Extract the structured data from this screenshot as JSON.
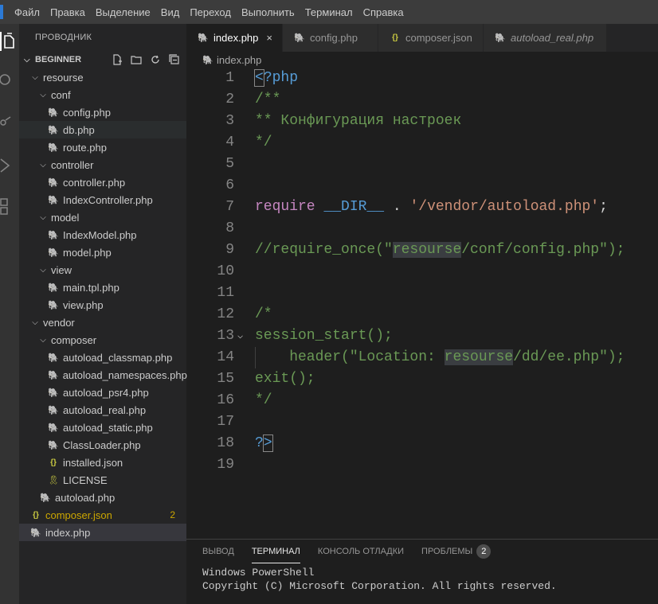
{
  "menu": [
    "Файл",
    "Правка",
    "Выделение",
    "Вид",
    "Переход",
    "Выполнить",
    "Терминал",
    "Справка"
  ],
  "activity_icons": [
    "files-icon",
    "search-icon",
    "source-control-icon",
    "run-debug-icon",
    "extensions-icon"
  ],
  "sidebar": {
    "title": "ПРОВОДНИК",
    "section": "BEGINNER",
    "actions": [
      "new-file-icon",
      "new-folder-icon",
      "refresh-icon",
      "collapse-all-icon"
    ],
    "tree": [
      {
        "label": "resourse",
        "type": "folder",
        "depth": 0
      },
      {
        "label": "conf",
        "type": "folder",
        "depth": 1
      },
      {
        "label": "config.php",
        "type": "php",
        "depth": 2
      },
      {
        "label": "db.php",
        "type": "php",
        "depth": 2,
        "hover": true
      },
      {
        "label": "route.php",
        "type": "php",
        "depth": 2
      },
      {
        "label": "controller",
        "type": "folder",
        "depth": 1
      },
      {
        "label": "controller.php",
        "type": "php",
        "depth": 2
      },
      {
        "label": "IndexController.php",
        "type": "php",
        "depth": 2
      },
      {
        "label": "model",
        "type": "folder",
        "depth": 1
      },
      {
        "label": "IndexModel.php",
        "type": "php",
        "depth": 2
      },
      {
        "label": "model.php",
        "type": "php",
        "depth": 2
      },
      {
        "label": "view",
        "type": "folder",
        "depth": 1
      },
      {
        "label": "main.tpl.php",
        "type": "php",
        "depth": 2
      },
      {
        "label": "view.php",
        "type": "php",
        "depth": 2
      },
      {
        "label": "vendor",
        "type": "folder",
        "depth": 0
      },
      {
        "label": "composer",
        "type": "folder",
        "depth": 1
      },
      {
        "label": "autoload_classmap.php",
        "type": "php",
        "depth": 2
      },
      {
        "label": "autoload_namespaces.php",
        "type": "php",
        "depth": 2
      },
      {
        "label": "autoload_psr4.php",
        "type": "php",
        "depth": 2
      },
      {
        "label": "autoload_real.php",
        "type": "php",
        "depth": 2
      },
      {
        "label": "autoload_static.php",
        "type": "php",
        "depth": 2
      },
      {
        "label": "ClassLoader.php",
        "type": "php",
        "depth": 2
      },
      {
        "label": "installed.json",
        "type": "json",
        "depth": 2
      },
      {
        "label": "LICENSE",
        "type": "license",
        "depth": 2
      },
      {
        "label": "autoload.php",
        "type": "php",
        "depth": 1
      },
      {
        "label": "composer.json",
        "type": "json",
        "depth": 0,
        "warning": true,
        "badge": "2"
      },
      {
        "label": "index.php",
        "type": "php",
        "depth": 0,
        "selected": true
      }
    ]
  },
  "tabs": [
    {
      "label": "index.php",
      "type": "php",
      "active": true,
      "close": "×"
    },
    {
      "label": "config.php",
      "type": "php"
    },
    {
      "label": "composer.json",
      "type": "json"
    },
    {
      "label": "autoload_real.php",
      "type": "php",
      "italic": true
    }
  ],
  "breadcrumb": "index.php",
  "editor": {
    "lines": [
      {
        "n": "1",
        "tokens": [
          {
            "t": "<",
            "c": "c-kw bx"
          },
          {
            "t": "?php",
            "c": "c-kw"
          }
        ]
      },
      {
        "n": "2",
        "tokens": [
          {
            "t": "/**",
            "c": "c-cm"
          }
        ]
      },
      {
        "n": "3",
        "tokens": [
          {
            "t": "** Конфигурация настроек",
            "c": "c-cm"
          }
        ]
      },
      {
        "n": "4",
        "tokens": [
          {
            "t": "*/",
            "c": "c-cm"
          }
        ]
      },
      {
        "n": "5",
        "tokens": []
      },
      {
        "n": "6",
        "tokens": []
      },
      {
        "n": "7",
        "tokens": [
          {
            "t": "require",
            "c": "c-ctl"
          },
          {
            "t": " ",
            "c": ""
          },
          {
            "t": "__DIR__",
            "c": "c-var"
          },
          {
            "t": " . ",
            "c": ""
          },
          {
            "t": "'/vendor/autoload.php'",
            "c": "c-str"
          },
          {
            "t": ";",
            "c": ""
          }
        ]
      },
      {
        "n": "8",
        "tokens": []
      },
      {
        "n": "9",
        "tokens": [
          {
            "t": "//require_once(\"",
            "c": "c-cm"
          },
          {
            "t": "resourse",
            "c": "c-cm wordhl"
          },
          {
            "t": "/conf/config.php\");",
            "c": "c-cm"
          }
        ]
      },
      {
        "n": "10",
        "tokens": []
      },
      {
        "n": "11",
        "tokens": []
      },
      {
        "n": "12",
        "tokens": [
          {
            "t": "/*",
            "c": "c-cm"
          }
        ]
      },
      {
        "n": "13",
        "fold": "⌵",
        "tokens": [
          {
            "t": "session_start();",
            "c": "c-cm"
          }
        ]
      },
      {
        "n": "14",
        "guide": true,
        "tokens": [
          {
            "t": "    header(\"Location: ",
            "c": "c-cm"
          },
          {
            "t": "resourse",
            "c": "c-cm wordhl"
          },
          {
            "t": "/dd/ee.php\");",
            "c": "c-cm"
          }
        ]
      },
      {
        "n": "15",
        "tokens": [
          {
            "t": "exit();",
            "c": "c-cm"
          }
        ]
      },
      {
        "n": "16",
        "tokens": [
          {
            "t": "*/",
            "c": "c-cm"
          }
        ]
      },
      {
        "n": "17",
        "tokens": []
      },
      {
        "n": "18",
        "tokens": [
          {
            "t": "?",
            "c": "c-kw"
          },
          {
            "t": ">",
            "c": "c-kw bx"
          }
        ]
      },
      {
        "n": "19",
        "tokens": []
      }
    ]
  },
  "panel": {
    "tabs": [
      {
        "label": "ВЫВОД"
      },
      {
        "label": "ТЕРМИНАЛ",
        "active": true
      },
      {
        "label": "КОНСОЛЬ ОТЛАДКИ"
      },
      {
        "label": "ПРОБЛЕМЫ",
        "badge": "2"
      }
    ],
    "terminal": [
      "Windows PowerShell",
      "Copyright (C) Microsoft Corporation. All rights reserved."
    ]
  },
  "colors": {
    "accent": "#007acc",
    "warning": "#cca700",
    "php_icon": "#a074c4",
    "json_icon": "#cbcb41"
  }
}
